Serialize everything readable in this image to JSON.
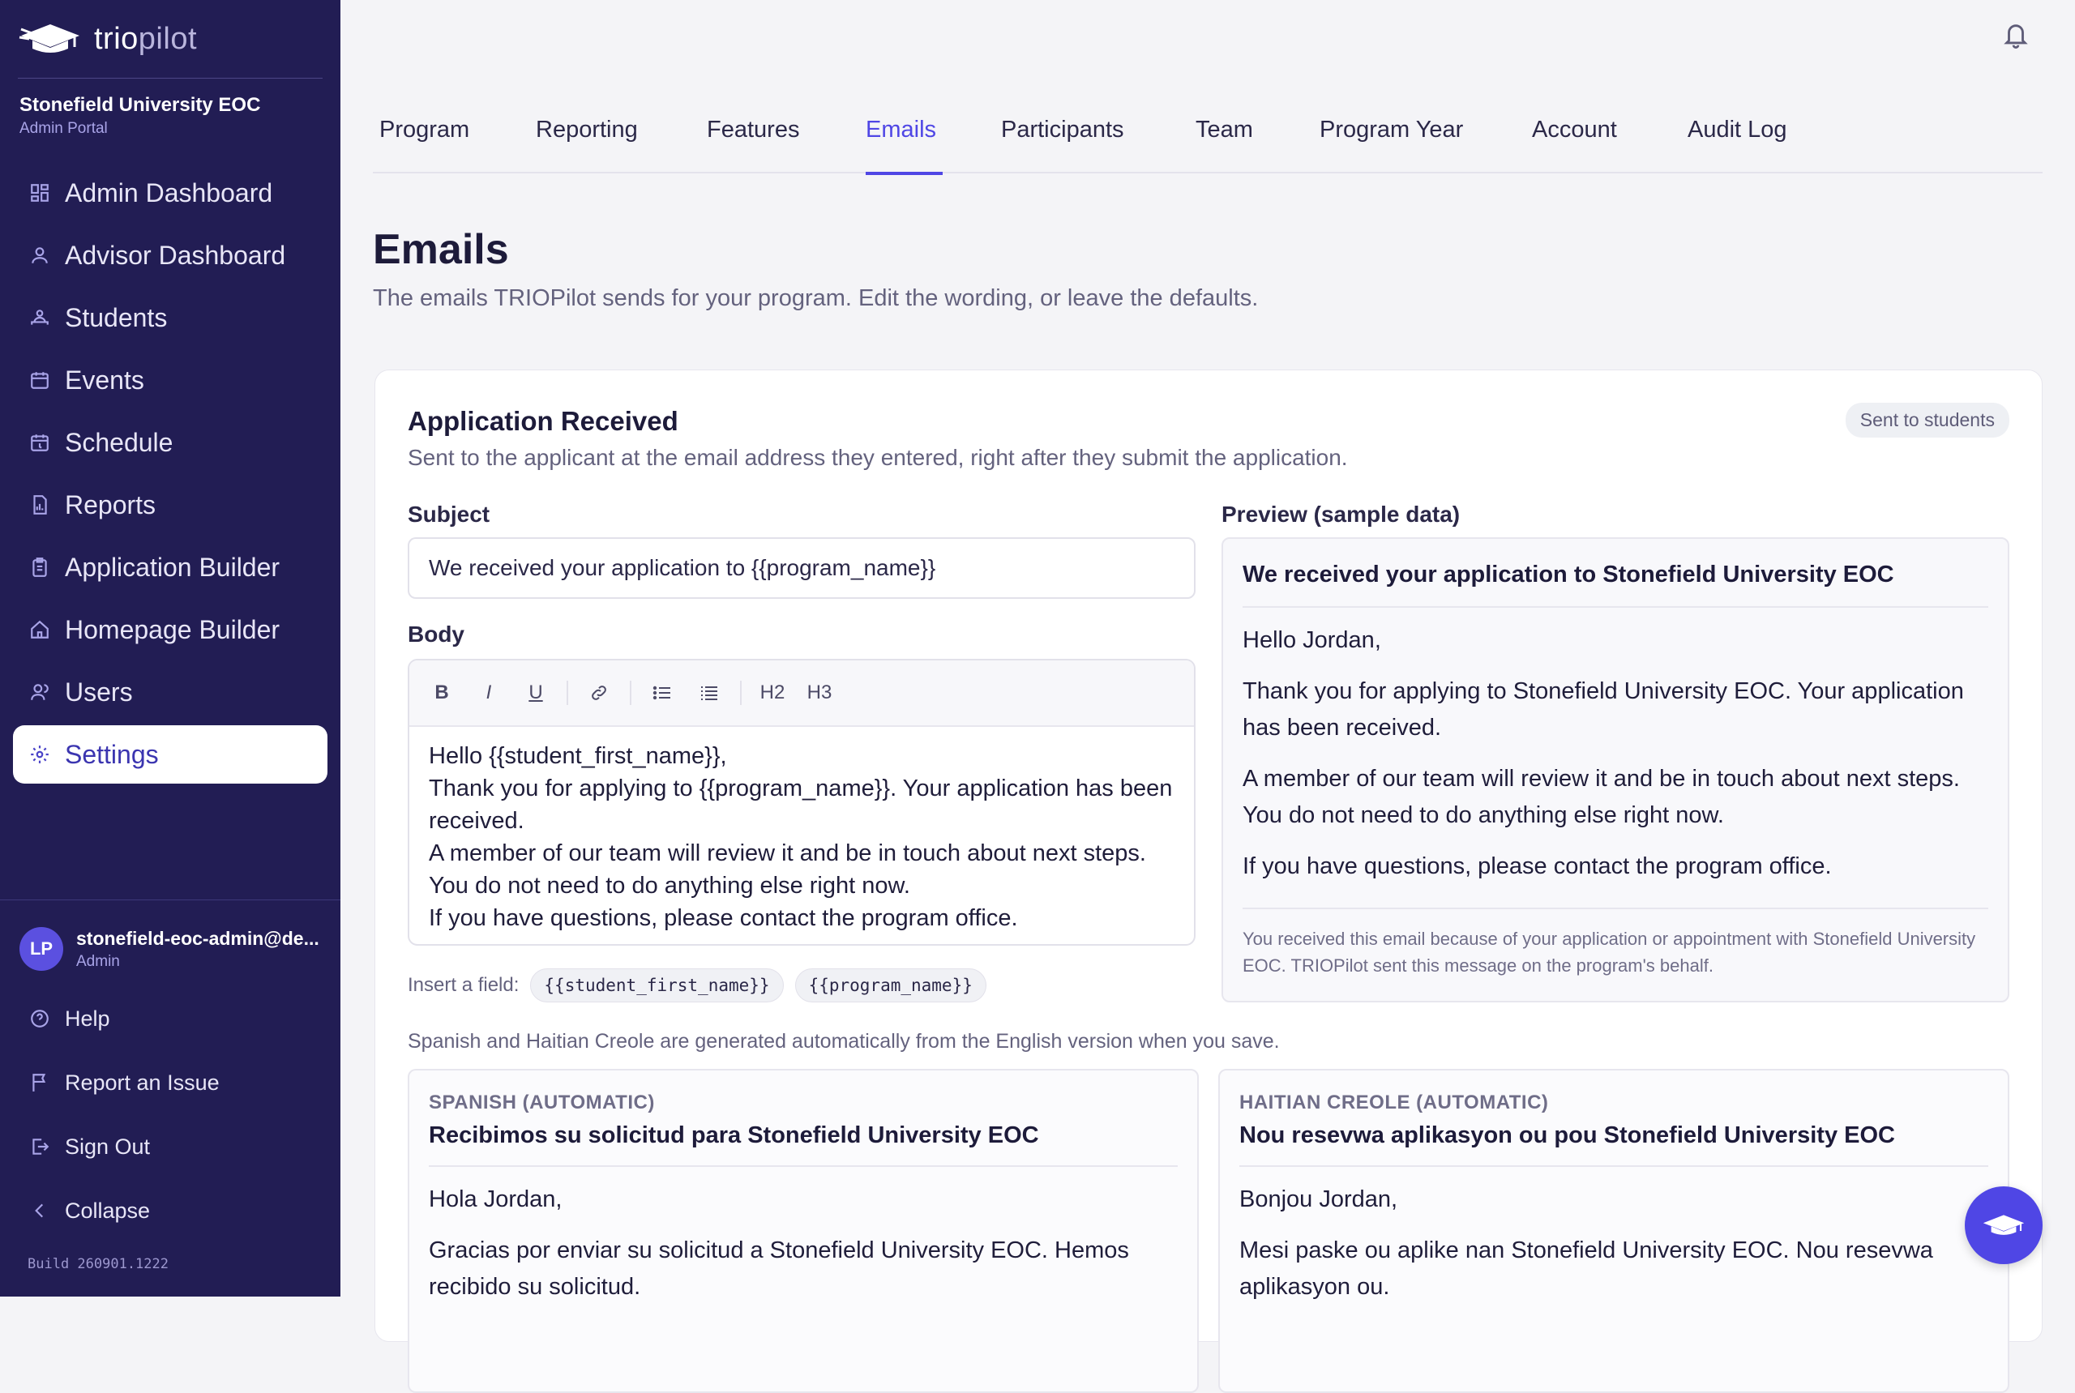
{
  "app": {
    "logo_left": "trio",
    "logo_right": "pilot",
    "org_name": "Stonefield University EOC",
    "org_sub": "Admin Portal"
  },
  "sidebar": {
    "items": [
      {
        "label": "Admin Dashboard",
        "icon": "dashboard-icon"
      },
      {
        "label": "Advisor Dashboard",
        "icon": "user-icon"
      },
      {
        "label": "Students",
        "icon": "students-icon"
      },
      {
        "label": "Events",
        "icon": "calendar-icon"
      },
      {
        "label": "Schedule",
        "icon": "schedule-icon"
      },
      {
        "label": "Reports",
        "icon": "report-icon"
      },
      {
        "label": "Application Builder",
        "icon": "clipboard-icon"
      },
      {
        "label": "Homepage Builder",
        "icon": "home-icon"
      },
      {
        "label": "Users",
        "icon": "users-icon"
      },
      {
        "label": "Settings",
        "icon": "gear-icon",
        "active": true
      }
    ],
    "user": {
      "initials": "LP",
      "email": "stonefield-eoc-admin@de...",
      "role": "Admin"
    },
    "bottom": [
      {
        "label": "Help",
        "icon": "help-icon"
      },
      {
        "label": "Report an Issue",
        "icon": "flag-icon"
      },
      {
        "label": "Sign Out",
        "icon": "sign-out-icon"
      },
      {
        "label": "Collapse",
        "icon": "chevron-left-icon"
      }
    ],
    "build": "Build 260901.1222"
  },
  "tabs": [
    "Program",
    "Reporting",
    "Features",
    "Emails",
    "Participants",
    "Team",
    "Program Year",
    "Account",
    "Audit Log"
  ],
  "active_tab": "Emails",
  "page": {
    "title": "Emails",
    "subtitle": "The emails TRIOPilot sends for your program. Edit the wording, or leave the defaults."
  },
  "email": {
    "title": "Application Received",
    "description": "Sent to the applicant at the email address they entered, right after they submit the application.",
    "badge": "Sent to students",
    "subject_label": "Subject",
    "subject_value": "We received your application to {{program_name}}",
    "body_label": "Body",
    "toolbar": {
      "bold": "B",
      "italic": "I",
      "underline": "U",
      "h2": "H2",
      "h3": "H3"
    },
    "body_lines": [
      "Hello {{student_first_name}},",
      "Thank you for applying to {{program_name}}. Your application has been received.",
      "A member of our team will review it and be in touch about next steps. You do not need to do anything else right now.",
      "If you have questions, please contact the program office."
    ],
    "insert_label": "Insert a field:",
    "fields": [
      "{{student_first_name}}",
      "{{program_name}}"
    ],
    "preview_label": "Preview (sample data)",
    "preview": {
      "subject": "We received your application to Stonefield University EOC",
      "paragraphs": [
        "Hello Jordan,",
        "Thank you for applying to Stonefield University EOC. Your application has been received.",
        "A member of our team will review it and be in touch about next steps. You do not need to do anything else right now.",
        "If you have questions, please contact the program office."
      ],
      "footer": "You received this email because of your application or appointment with Stonefield University EOC. TRIOPilot sent this message on the program's behalf."
    },
    "auto_note": "Spanish and Haitian Creole are generated automatically from the English version when you save.",
    "spanish": {
      "caption": "SPANISH (AUTOMATIC)",
      "subject": "Recibimos su solicitud para Stonefield University EOC",
      "paragraphs": [
        "Hola Jordan,",
        "Gracias por enviar su solicitud a Stonefield University EOC. Hemos recibido su solicitud."
      ]
    },
    "creole": {
      "caption": "HAITIAN CREOLE (AUTOMATIC)",
      "subject": "Nou resevwa aplikasyon ou pou Stonefield University EOC",
      "paragraphs": [
        "Bonjou Jordan,",
        "Mesi paske ou aplike nan Stonefield University EOC. Nou resevwa aplikasyon ou."
      ]
    }
  },
  "colors": {
    "sidebar": "#221d54",
    "accent": "#4f46e5"
  }
}
